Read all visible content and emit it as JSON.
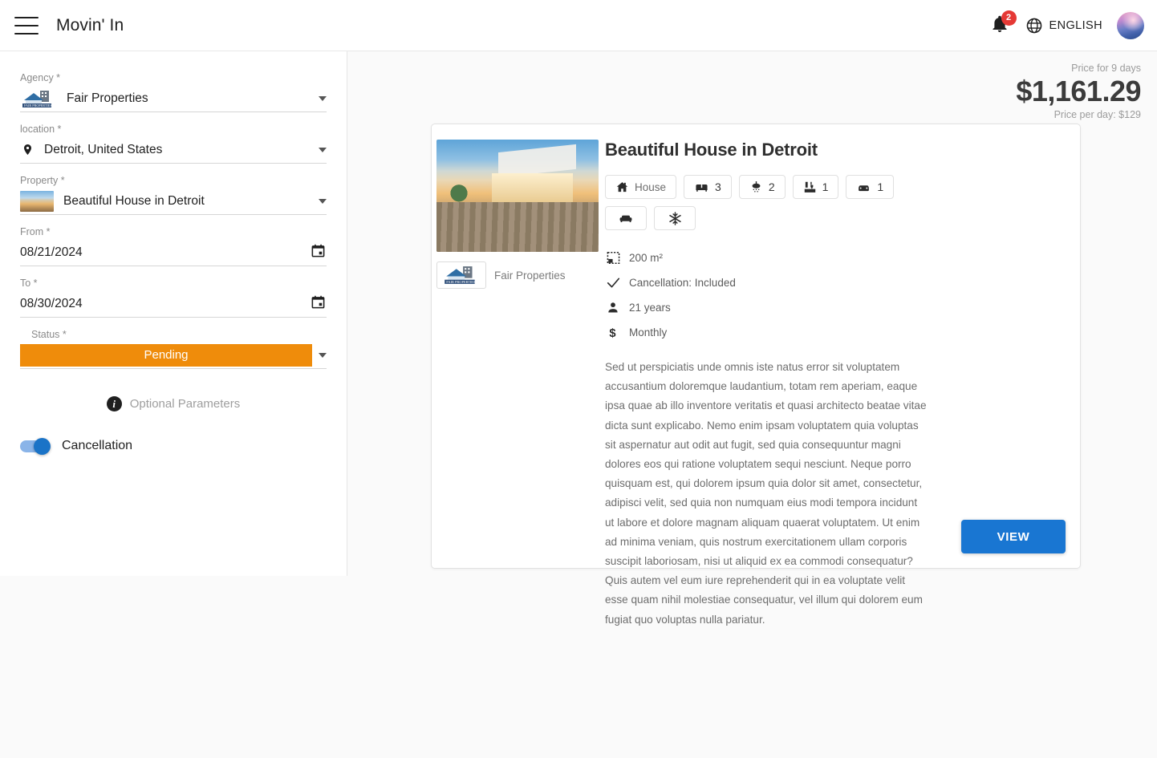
{
  "header": {
    "title": "Movin' In",
    "menu_icon": "hamburger-menu-icon",
    "notification_icon": "bell-icon",
    "notification_count": "2",
    "globe_icon": "globe-icon",
    "language": "ENGLISH",
    "avatar_icon": "user-avatar"
  },
  "sidebar": {
    "agency": {
      "label": "Agency *",
      "value": "Fair Properties",
      "logo_icon": "fair-properties-logo"
    },
    "location": {
      "label": "location *",
      "value": "Detroit, United States",
      "icon": "map-pin-icon"
    },
    "property": {
      "label": "Property *",
      "value": "Beautiful House in Detroit",
      "icon": "property-thumbnail"
    },
    "from": {
      "label": "From *",
      "value": "08/21/2024",
      "icon": "calendar-icon"
    },
    "to": {
      "label": "To *",
      "value": "08/30/2024",
      "icon": "calendar-icon"
    },
    "status": {
      "label": "Status *",
      "value": "Pending",
      "color": "#ef8c0b"
    },
    "optional_parameters": {
      "label": "Optional Parameters",
      "icon": "info-icon"
    },
    "cancellation": {
      "label": "Cancellation",
      "enabled": true
    }
  },
  "main": {
    "price": {
      "caption": "Price for 9 days",
      "amount": "$1,161.29",
      "per_day": "Price per day: $129"
    },
    "card": {
      "title": "Beautiful House in Detroit",
      "photo_icon": "property-photo",
      "agency_name": "Fair Properties",
      "agency_logo_icon": "fair-properties-logo",
      "chips": [
        {
          "icon": "home-icon",
          "text": "House",
          "value": ""
        },
        {
          "icon": "bed-icon",
          "text": "",
          "value": "3"
        },
        {
          "icon": "shower-icon",
          "text": "",
          "value": "2"
        },
        {
          "icon": "kitchen-icon",
          "text": "",
          "value": "1"
        },
        {
          "icon": "car-icon",
          "text": "",
          "value": "1"
        },
        {
          "icon": "sofa-icon",
          "text": "",
          "value": ""
        },
        {
          "icon": "snowflake-icon",
          "text": "",
          "value": ""
        }
      ],
      "details": [
        {
          "icon": "area-icon",
          "text": "200 m²"
        },
        {
          "icon": "check-icon",
          "text": "Cancellation: Included"
        },
        {
          "icon": "person-icon",
          "text": "21 years"
        },
        {
          "icon": "dollar-icon",
          "text": "Monthly"
        }
      ],
      "description": "Sed ut perspiciatis unde omnis iste natus error sit voluptatem accusantium doloremque laudantium, totam rem aperiam, eaque ipsa quae ab illo inventore veritatis et quasi architecto beatae vitae dicta sunt explicabo. Nemo enim ipsam voluptatem quia voluptas sit aspernatur aut odit aut fugit, sed quia consequuntur magni dolores eos qui ratione voluptatem sequi nesciunt. Neque porro quisquam est, qui dolorem ipsum quia dolor sit amet, consectetur, adipisci velit, sed quia non numquam eius modi tempora incidunt ut labore et dolore magnam aliquam quaerat voluptatem. Ut enim ad minima veniam, quis nostrum exercitationem ullam corporis suscipit laboriosam, nisi ut aliquid ex ea commodi consequatur? Quis autem vel eum iure reprehenderit qui in ea voluptate velit esse quam nihil molestiae consequatur, vel illum qui dolorem eum fugiat quo voluptas nulla pariatur.",
      "view_button": "VIEW"
    }
  }
}
